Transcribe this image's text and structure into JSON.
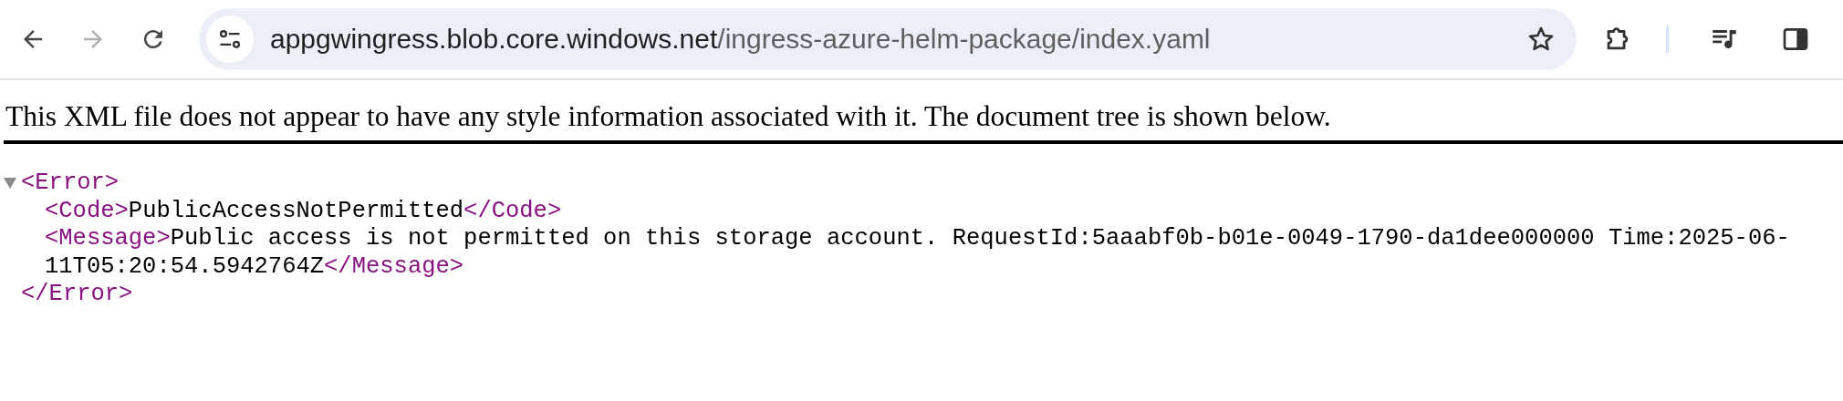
{
  "address_bar": {
    "host": "appgwingress.blob.core.windows.net",
    "path": "/ingress-azure-helm-package/index.yaml"
  },
  "notice": "This XML file does not appear to have any style information associated with it. The document tree is shown below.",
  "tree": {
    "open": "<Error>",
    "close": "</Error>",
    "expanded": true,
    "children": [
      {
        "open": "<Code>",
        "text": "PublicAccessNotPermitted",
        "close": "</Code>"
      },
      {
        "open": "<Message>",
        "text": "Public access is not permitted on this storage account. RequestId:5aaabf0b-b01e-0049-1790-da1dee000000 Time:2025-06-11T05:20:54.5942764Z",
        "close": "</Message>"
      }
    ]
  }
}
